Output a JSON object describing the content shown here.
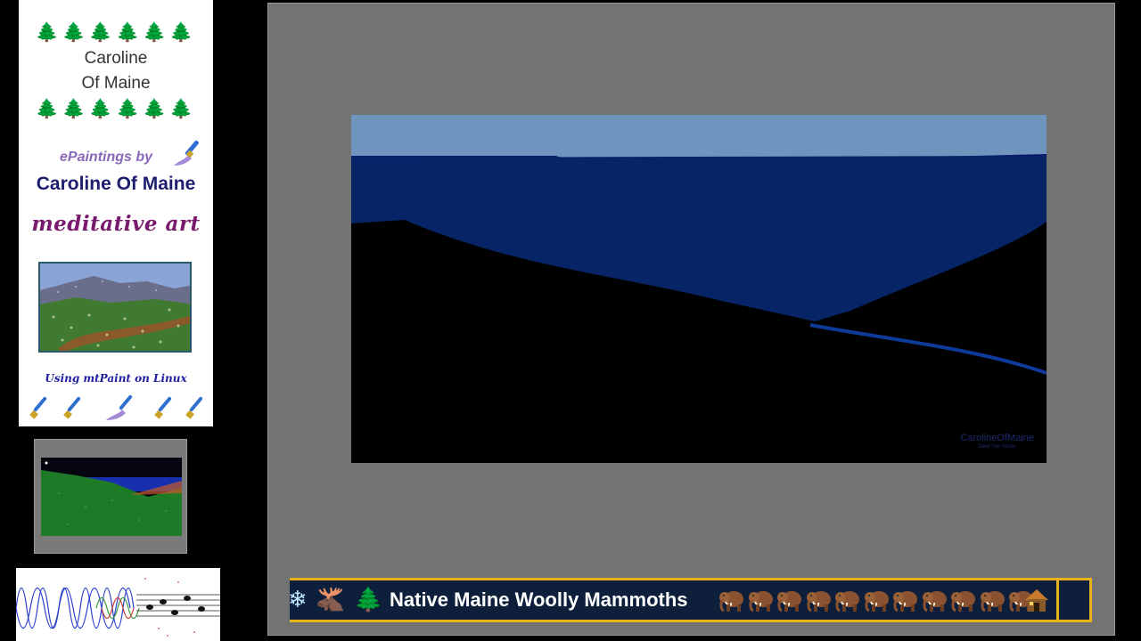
{
  "brand": {
    "name_line_1": "Caroline",
    "name_line_2": "Of Maine",
    "epaintings_by": "ePaintings by",
    "title": "Caroline Of Maine",
    "tagline": "meditative art",
    "using": "Using mtPaint on Linux",
    "tree_glyphs": "🌲🌲🌲🌲🌲🌲"
  },
  "painting": {
    "watermark_name": "CarolineOfMaine",
    "watermark_sub": "Deer Isle Stone"
  },
  "ticker": {
    "icons": [
      "snowflake-icon",
      "moose-icon",
      "tree-icon"
    ],
    "snowflake": "❄",
    "moose": "🫎",
    "tree": "🌲",
    "text": "Native Maine Woolly Mammoths",
    "mammoth_count": 11
  },
  "colors": {
    "ticker_border": "#e9b21a",
    "ticker_bg": "#0d1f3a",
    "canvas_bg": "#737373",
    "sky": "#6f95bf",
    "water": "#062466"
  }
}
